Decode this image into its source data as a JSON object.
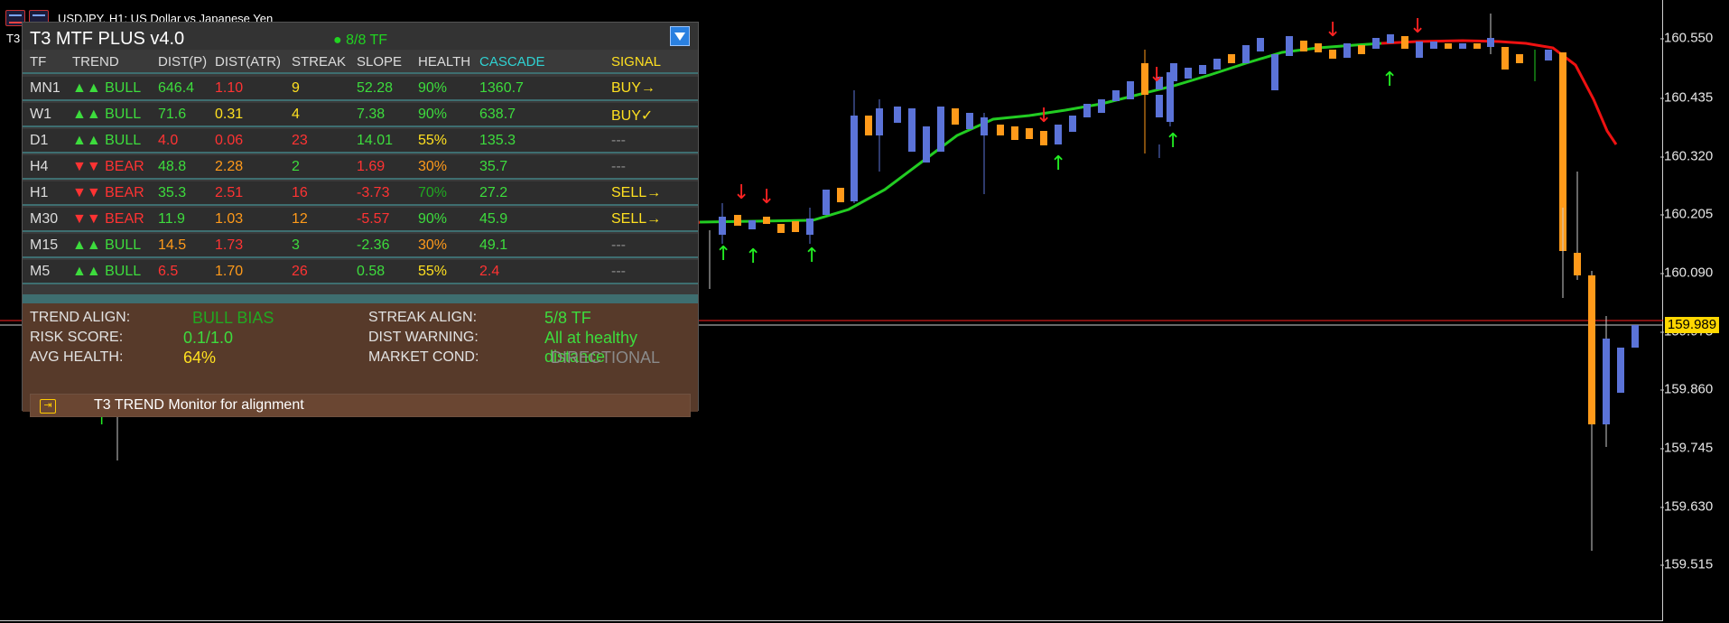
{
  "window": {
    "title": "USDJPY, H1:  US Dollar vs Japanese Yen",
    "left_number": "T3"
  },
  "price_axis": {
    "ticks": [
      "160.550",
      "160.435",
      "160.320",
      "160.205",
      "160.090",
      "159.975",
      "159.860",
      "159.745",
      "159.630",
      "159.515"
    ],
    "current_price": "159.989"
  },
  "panel": {
    "title": "T3 MTF PLUS v4.0",
    "tf_status": "● 8/8 TF",
    "headers": {
      "tf": "TF",
      "trend": "TREND",
      "dist_p": "DIST(P)",
      "dist_atr": "DIST(ATR)",
      "streak": "STREAK",
      "slope": "SLOPE",
      "health": "HEALTH",
      "cascade": "CASCADE",
      "signal": "SIGNAL"
    },
    "rows": [
      {
        "tf": "MN1",
        "trend": "▲▲ BULL",
        "dist_p": "646.4",
        "dist_atr": "1.10",
        "streak": "9",
        "slope": "52.28",
        "health": "90%",
        "cascade": "1360.7",
        "signal": "BUY→"
      },
      {
        "tf": "W1",
        "trend": "▲▲ BULL",
        "dist_p": "71.6",
        "dist_atr": "0.31",
        "streak": "4",
        "slope": "7.38",
        "health": "90%",
        "cascade": "638.7",
        "signal": "BUY✓"
      },
      {
        "tf": "D1",
        "trend": "▲▲ BULL",
        "dist_p": "4.0",
        "dist_atr": "0.06",
        "streak": "23",
        "slope": "14.01",
        "health": "55%",
        "cascade": "135.3",
        "signal": "---"
      },
      {
        "tf": "H4",
        "trend": "▼▼ BEAR",
        "dist_p": "48.8",
        "dist_atr": "2.28",
        "streak": "2",
        "slope": "1.69",
        "health": "30%",
        "cascade": "35.7",
        "signal": "---"
      },
      {
        "tf": "H1",
        "trend": "▼▼ BEAR",
        "dist_p": "35.3",
        "dist_atr": "2.51",
        "streak": "16",
        "slope": "-3.73",
        "health": "70%",
        "cascade": "27.2",
        "signal": "SELL→"
      },
      {
        "tf": "M30",
        "trend": "▼▼ BEAR",
        "dist_p": "11.9",
        "dist_atr": "1.03",
        "streak": "12",
        "slope": "-5.57",
        "health": "90%",
        "cascade": "45.9",
        "signal": "SELL→"
      },
      {
        "tf": "M15",
        "trend": "▲▲ BULL",
        "dist_p": "14.5",
        "dist_atr": "1.73",
        "streak": "3",
        "slope": "-2.36",
        "health": "30%",
        "cascade": "49.1",
        "signal": "---"
      },
      {
        "tf": "M5",
        "trend": "▲▲ BULL",
        "dist_p": "6.5",
        "dist_atr": "1.70",
        "streak": "26",
        "slope": "0.58",
        "health": "55%",
        "cascade": "2.4",
        "signal": "---"
      }
    ],
    "summary": {
      "trend_align_label": "TREND ALIGN:",
      "trend_align_value": "BULL BIAS",
      "risk_score_label": "RISK SCORE:",
      "risk_score_value": "0.1/1.0",
      "avg_health_label": "AVG HEALTH:",
      "avg_health_value": "64%",
      "streak_align_label": "STREAK ALIGN:",
      "streak_align_value": "5/8 TF",
      "dist_warning_label": "DIST WARNING:",
      "dist_warning_value": "All at healthy distance",
      "market_cond_label": "MARKET COND:",
      "market_cond_value": "DIRECTIONAL"
    },
    "monitor_text": "T3 TREND Monitor for alignment"
  },
  "colors": {
    "bull": "#3ddc3d",
    "bear": "#ff3333",
    "bull_candle": "#5b73d8",
    "bear_candle": "#ff9a1a",
    "ma_up": "#22cc22",
    "ma_down": "#ee1111",
    "current_price": "#ffd700"
  }
}
